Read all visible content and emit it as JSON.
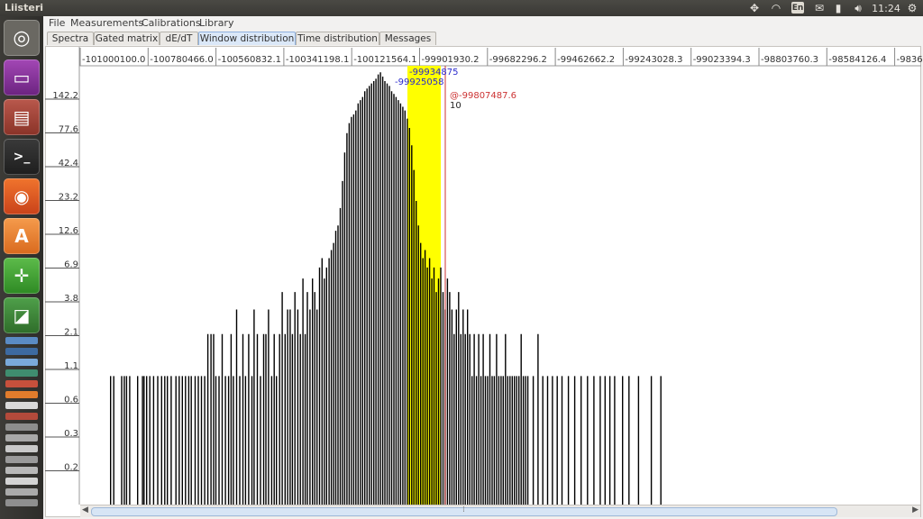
{
  "window": {
    "title": "Liisteri",
    "clock": "11:24",
    "lang": "En"
  },
  "menu": [
    "File",
    "Measurements",
    "Calibrations",
    "Library"
  ],
  "tabs": [
    {
      "label": "Spectra",
      "active": false
    },
    {
      "label": "Gated matrix",
      "active": false
    },
    {
      "label": "dE/dT",
      "active": false
    },
    {
      "label": "Window distribution",
      "active": true
    },
    {
      "label": "Time distribution",
      "active": false
    },
    {
      "label": "Messages",
      "active": false
    }
  ],
  "launcher": [
    "ubuntu-dash-icon",
    "files-app-icon",
    "file-cabinet-icon",
    "terminal-icon",
    "firefox-icon",
    "software-center-icon",
    "geogebra-icon",
    "workspace-switcher-icon",
    "stacked-apps-icon"
  ],
  "chart_data": {
    "type": "bar",
    "x_ticks": [
      "-101000100.0",
      "-100780466.0",
      "-100560832.1",
      "-100341198.1",
      "-100121564.1",
      "-99901930.2",
      "-99682296.2",
      "-99462662.2",
      "-99243028.3",
      "-99023394.3",
      "-98803760.3",
      "-98584126.4",
      "-9836"
    ],
    "y_ticks": [
      "142.2",
      "77.6",
      "42.4",
      "23.2",
      "12.6",
      "6.9",
      "3.8",
      "2.1",
      "1.1",
      "0.6",
      "0.3",
      "0.2"
    ],
    "y_scale": "log",
    "highlight_window_color": "#ffff00",
    "peak_annotation": "-99934875",
    "peak_annotation2": "-99925058",
    "cursor_label": "@-99807487.6",
    "cursor_value": "10",
    "cursor_color": "#cc3333",
    "histogram": [
      [
        -100905000,
        1
      ],
      [
        -100895000,
        1
      ],
      [
        -100870000,
        1
      ],
      [
        -100862000,
        1
      ],
      [
        -100855000,
        1
      ],
      [
        -100845000,
        1
      ],
      [
        -100820000,
        1
      ],
      [
        -100805000,
        1
      ],
      [
        -100800000,
        1
      ],
      [
        -100792000,
        1
      ],
      [
        -100782000,
        1
      ],
      [
        -100770000,
        1
      ],
      [
        -100757000,
        1
      ],
      [
        -100745000,
        1
      ],
      [
        -100735000,
        1
      ],
      [
        -100727000,
        1
      ],
      [
        -100715000,
        1
      ],
      [
        -100700000,
        1
      ],
      [
        -100690000,
        1
      ],
      [
        -100680000,
        1
      ],
      [
        -100670000,
        1
      ],
      [
        -100660000,
        1
      ],
      [
        -100652000,
        1
      ],
      [
        -100640000,
        1
      ],
      [
        -100630000,
        1
      ],
      [
        -100620000,
        1
      ],
      [
        -100610000,
        1
      ],
      [
        -100600000,
        2
      ],
      [
        -100590000,
        2
      ],
      [
        -100582000,
        2
      ],
      [
        -100575000,
        1
      ],
      [
        -100565000,
        1
      ],
      [
        -100555000,
        2
      ],
      [
        -100545000,
        1
      ],
      [
        -100535000,
        1
      ],
      [
        -100527000,
        2
      ],
      [
        -100520000,
        1
      ],
      [
        -100510000,
        3
      ],
      [
        -100500000,
        1
      ],
      [
        -100490000,
        2
      ],
      [
        -100482000,
        1
      ],
      [
        -100472000,
        2
      ],
      [
        -100462000,
        1
      ],
      [
        -100455000,
        3
      ],
      [
        -100445000,
        2
      ],
      [
        -100435000,
        1
      ],
      [
        -100425000,
        2
      ],
      [
        -100418000,
        2
      ],
      [
        -100410000,
        3
      ],
      [
        -100400000,
        1
      ],
      [
        -100392000,
        2
      ],
      [
        -100385000,
        1
      ],
      [
        -100375000,
        2
      ],
      [
        -100367000,
        4
      ],
      [
        -100358000,
        2
      ],
      [
        -100350000,
        3
      ],
      [
        -100342000,
        3
      ],
      [
        -100335000,
        2
      ],
      [
        -100327000,
        4
      ],
      [
        -100318000,
        3
      ],
      [
        -100310000,
        2
      ],
      [
        -100302000,
        5
      ],
      [
        -100295000,
        2
      ],
      [
        -100288000,
        4
      ],
      [
        -100280000,
        3
      ],
      [
        -100272000,
        5
      ],
      [
        -100265000,
        4
      ],
      [
        -100258000,
        3
      ],
      [
        -100250000,
        6
      ],
      [
        -100242000,
        7
      ],
      [
        -100235000,
        5
      ],
      [
        -100228000,
        6
      ],
      [
        -100220000,
        7
      ],
      [
        -100213000,
        8
      ],
      [
        -100206000,
        9
      ],
      [
        -100199000,
        11
      ],
      [
        -100192000,
        12
      ],
      [
        -100185000,
        16
      ],
      [
        -100178000,
        25
      ],
      [
        -100171000,
        40
      ],
      [
        -100164000,
        55
      ],
      [
        -100157000,
        65
      ],
      [
        -100150000,
        72
      ],
      [
        -100143000,
        75
      ],
      [
        -100136000,
        80
      ],
      [
        -100129000,
        90
      ],
      [
        -100122000,
        95
      ],
      [
        -100115000,
        100
      ],
      [
        -100108000,
        110
      ],
      [
        -100101000,
        115
      ],
      [
        -100094000,
        120
      ],
      [
        -100087000,
        125
      ],
      [
        -100080000,
        130
      ],
      [
        -100073000,
        135
      ],
      [
        -100066000,
        145
      ],
      [
        -100059000,
        150
      ],
      [
        -100052000,
        140
      ],
      [
        -100045000,
        130
      ],
      [
        -100038000,
        125
      ],
      [
        -100031000,
        120
      ],
      [
        -100024000,
        110
      ],
      [
        -100017000,
        105
      ],
      [
        -100010000,
        100
      ],
      [
        -100003000,
        95
      ],
      [
        -99996000,
        90
      ],
      [
        -99989000,
        85
      ],
      [
        -99982000,
        80
      ],
      [
        -99975000,
        70
      ],
      [
        -99968000,
        60
      ],
      [
        -99961000,
        45
      ],
      [
        -99954000,
        30
      ],
      [
        -99947000,
        18
      ],
      [
        -99940000,
        12
      ],
      [
        -99933000,
        9
      ],
      [
        -99926000,
        7
      ],
      [
        -99919000,
        8
      ],
      [
        -99912000,
        6
      ],
      [
        -99905000,
        7
      ],
      [
        -99898000,
        5
      ],
      [
        -99891000,
        6
      ],
      [
        -99884000,
        4
      ],
      [
        -99877000,
        5
      ],
      [
        -99870000,
        6
      ],
      [
        -99863000,
        4
      ],
      [
        -99856000,
        3
      ],
      [
        -99849000,
        5
      ],
      [
        -99842000,
        4
      ],
      [
        -99835000,
        3
      ],
      [
        -99828000,
        2
      ],
      [
        -99821000,
        3
      ],
      [
        -99814000,
        4
      ],
      [
        -99807000,
        2
      ],
      [
        -99800000,
        3
      ],
      [
        -99793000,
        2
      ],
      [
        -99786000,
        3
      ],
      [
        -99779000,
        2
      ],
      [
        -99772000,
        1
      ],
      [
        -99765000,
        2
      ],
      [
        -99758000,
        1
      ],
      [
        -99751000,
        2
      ],
      [
        -99744000,
        1
      ],
      [
        -99737000,
        2
      ],
      [
        -99730000,
        1
      ],
      [
        -99723000,
        1
      ],
      [
        -99716000,
        2
      ],
      [
        -99709000,
        1
      ],
      [
        -99702000,
        1
      ],
      [
        -99695000,
        2
      ],
      [
        -99688000,
        1
      ],
      [
        -99681000,
        1
      ],
      [
        -99674000,
        1
      ],
      [
        -99667000,
        2
      ],
      [
        -99660000,
        1
      ],
      [
        -99653000,
        1
      ],
      [
        -99646000,
        1
      ],
      [
        -99639000,
        1
      ],
      [
        -99632000,
        1
      ],
      [
        -99625000,
        1
      ],
      [
        -99618000,
        2
      ],
      [
        -99611000,
        1
      ],
      [
        -99604000,
        1
      ],
      [
        -99597000,
        1
      ],
      [
        -99580000,
        1
      ],
      [
        -99565000,
        2
      ],
      [
        -99550000,
        1
      ],
      [
        -99535000,
        1
      ],
      [
        -99520000,
        1
      ],
      [
        -99505000,
        1
      ],
      [
        -99490000,
        1
      ],
      [
        -99470000,
        1
      ],
      [
        -99450000,
        1
      ],
      [
        -99430000,
        1
      ],
      [
        -99410000,
        1
      ],
      [
        -99390000,
        1
      ],
      [
        -99370000,
        1
      ],
      [
        -99355000,
        1
      ],
      [
        -99340000,
        1
      ],
      [
        -99325000,
        1
      ],
      [
        -99300000,
        1
      ],
      [
        -99280000,
        1
      ],
      [
        -99250000,
        1
      ],
      [
        -99210000,
        1
      ],
      [
        -99180000,
        1
      ]
    ]
  }
}
